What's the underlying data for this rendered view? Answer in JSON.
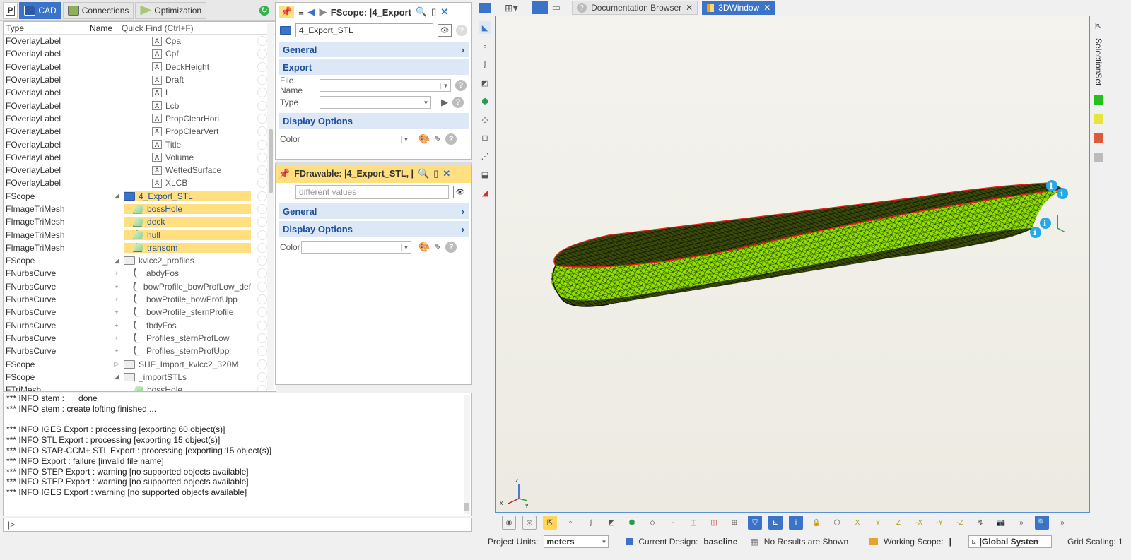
{
  "left_tabs": [
    {
      "label": "P",
      "icon": "project-icon"
    },
    {
      "label": "CAD",
      "icon": "cad-folder-icon",
      "active": true
    },
    {
      "label": "Connections",
      "icon": "monitor-icon"
    },
    {
      "label": "Optimization",
      "icon": "play-icon"
    }
  ],
  "tree": {
    "header": {
      "type": "Type",
      "name": "Name",
      "quick_find": "Quick Find (Ctrl+F)"
    },
    "rows": [
      {
        "type": "FOverlayLabel",
        "name": "Cpa",
        "icon": "label-icon",
        "exp": ""
      },
      {
        "type": "FOverlayLabel",
        "name": "Cpf",
        "icon": "label-icon",
        "exp": ""
      },
      {
        "type": "FOverlayLabel",
        "name": "DeckHeight",
        "icon": "label-icon",
        "exp": ""
      },
      {
        "type": "FOverlayLabel",
        "name": "Draft",
        "icon": "label-icon",
        "exp": ""
      },
      {
        "type": "FOverlayLabel",
        "name": "L",
        "icon": "label-icon",
        "exp": ""
      },
      {
        "type": "FOverlayLabel",
        "name": "Lcb",
        "icon": "label-icon",
        "exp": ""
      },
      {
        "type": "FOverlayLabel",
        "name": "PropClearHori",
        "icon": "label-icon",
        "exp": ""
      },
      {
        "type": "FOverlayLabel",
        "name": "PropClearVert",
        "icon": "label-icon",
        "exp": ""
      },
      {
        "type": "FOverlayLabel",
        "name": "Title",
        "icon": "label-icon",
        "exp": ""
      },
      {
        "type": "FOverlayLabel",
        "name": "Volume",
        "icon": "label-icon",
        "exp": ""
      },
      {
        "type": "FOverlayLabel",
        "name": "WettedSurface",
        "icon": "label-icon",
        "exp": ""
      },
      {
        "type": "FOverlayLabel",
        "name": "XLCB",
        "icon": "label-icon",
        "exp": ""
      },
      {
        "type": "FScope",
        "name": "4_Export_STL",
        "icon": "blue-folder-icon",
        "exp": "◢",
        "sel": true
      },
      {
        "type": "FImageTriMesh",
        "name": "bossHole",
        "icon": "mesh-icon",
        "exp": "",
        "sel": true,
        "indent": true
      },
      {
        "type": "FImageTriMesh",
        "name": "deck",
        "icon": "mesh-icon",
        "exp": "",
        "sel": true,
        "indent": true
      },
      {
        "type": "FImageTriMesh",
        "name": "hull",
        "icon": "mesh-icon",
        "exp": "",
        "sel": true,
        "indent": true
      },
      {
        "type": "FImageTriMesh",
        "name": "transom",
        "icon": "mesh-icon",
        "exp": "",
        "sel": true,
        "indent": true
      },
      {
        "type": "FScope",
        "name": "kvlcc2_profiles",
        "icon": "folder-icon",
        "exp": "◢"
      },
      {
        "type": "FNurbsCurve",
        "name": "abdyFos",
        "icon": "curve-icon",
        "exp": "+",
        "indent": true
      },
      {
        "type": "FNurbsCurve",
        "name": "bowProfile_bowProfLow_def",
        "icon": "curve-icon",
        "exp": "+",
        "indent": true
      },
      {
        "type": "FNurbsCurve",
        "name": "bowProfile_bowProfUpp",
        "icon": "curve-icon",
        "exp": "+",
        "indent": true
      },
      {
        "type": "FNurbsCurve",
        "name": "bowProfile_sternProfile",
        "icon": "curve-icon",
        "exp": "+",
        "indent": true
      },
      {
        "type": "FNurbsCurve",
        "name": "fbdyFos",
        "icon": "curve-icon",
        "exp": "+",
        "indent": true
      },
      {
        "type": "FNurbsCurve",
        "name": "Profiles_sternProfLow",
        "icon": "curve-icon",
        "exp": "+",
        "indent": true
      },
      {
        "type": "FNurbsCurve",
        "name": "Profiles_sternProfUpp",
        "icon": "curve-icon",
        "exp": "+",
        "indent": true
      },
      {
        "type": "FScope",
        "name": "SHF_Import_kvlcc2_320M",
        "icon": "folder-icon",
        "exp": "▷"
      },
      {
        "type": "FScope",
        "name": "_importSTLs",
        "icon": "folder-icon",
        "exp": "◢"
      },
      {
        "type": "FTriMesh",
        "name": "bossHole",
        "icon": "mesh-icon",
        "exp": "",
        "indent": true
      }
    ]
  },
  "scope_panel": {
    "title": "FScope: |4_Export",
    "name_value": "4_Export_STL",
    "sections": {
      "general": "General",
      "export": "Export",
      "display": "Display Options"
    },
    "props": {
      "file_name": "File Name",
      "type": "Type",
      "color": "Color"
    }
  },
  "drawable_panel": {
    "title": "FDrawable: |4_Export_STL, |",
    "placeholder": "different values",
    "sections": {
      "general": "General",
      "display": "Display Options"
    },
    "props": {
      "color": "Color"
    }
  },
  "console": {
    "lines": [
      "*** INFO stem :      done",
      "*** INFO stem : create lofting finished ...",
      "",
      "*** INFO IGES Export : processing [exporting 60 object(s)]",
      "*** INFO STL Export : processing [exporting 15 object(s)]",
      "*** INFO STAR-CCM+ STL Export : processing [exporting 15 object(s)]",
      "*** INFO Export : failure [invalid file name]",
      "*** INFO STEP Export : warning [no supported objects available]",
      "*** INFO STEP Export : warning [no supported objects available]",
      "*** INFO IGES Export : warning [no supported objects available]"
    ],
    "prompt": "|>"
  },
  "view_tabs": [
    {
      "label": "Documentation Browser",
      "icon": "help-icon"
    },
    {
      "label": "3DWindow",
      "icon": "chart-icon",
      "active": true
    }
  ],
  "right_panel": {
    "selection_set": "SelectionSet"
  },
  "colors": {
    "accent": "#3b73c8",
    "selection": "#ffdf80",
    "mesh": "#8ee000",
    "edge": "#e0201a",
    "section_bg": "#dce8f5"
  },
  "status": {
    "project_units_label": "Project Units:",
    "project_units": "meters",
    "current_design_label": "Current Design:",
    "current_design": "baseline",
    "results": "No Results are Shown",
    "working_scope_label": "Working Scope:",
    "working_scope": "|",
    "coord_system": "|Global Systen",
    "grid_scaling": "Grid Scaling: 1"
  },
  "axes": {
    "x": "x",
    "y": "y",
    "z": "z"
  }
}
